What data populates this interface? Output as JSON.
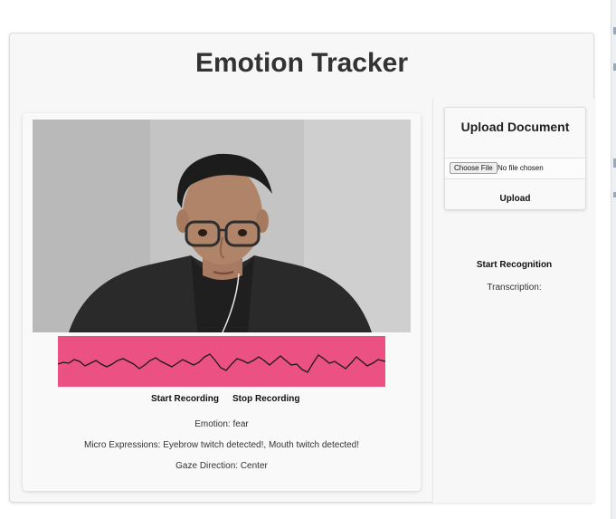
{
  "app": {
    "title": "Emotion Tracker"
  },
  "recording": {
    "start_label": "Start Recording",
    "stop_label": "Stop Recording"
  },
  "analysis": {
    "emotion": "Emotion: fear",
    "micro_expressions": "Micro Expressions: Eyebrow twitch detected!, Mouth twitch detected!",
    "gaze": "Gaze Direction: Center"
  },
  "upload": {
    "title": "Upload Document",
    "choose_file_label": "Choose File",
    "no_file_text": "No file chosen",
    "upload_label": "Upload"
  },
  "recognition": {
    "start_label": "Start Recognition",
    "transcription_label": "Transcription:"
  },
  "colors": {
    "waveform_bg": "#ec5184",
    "waveform_line": "#1a1a1a",
    "card_bg": "#f7f7f7"
  }
}
